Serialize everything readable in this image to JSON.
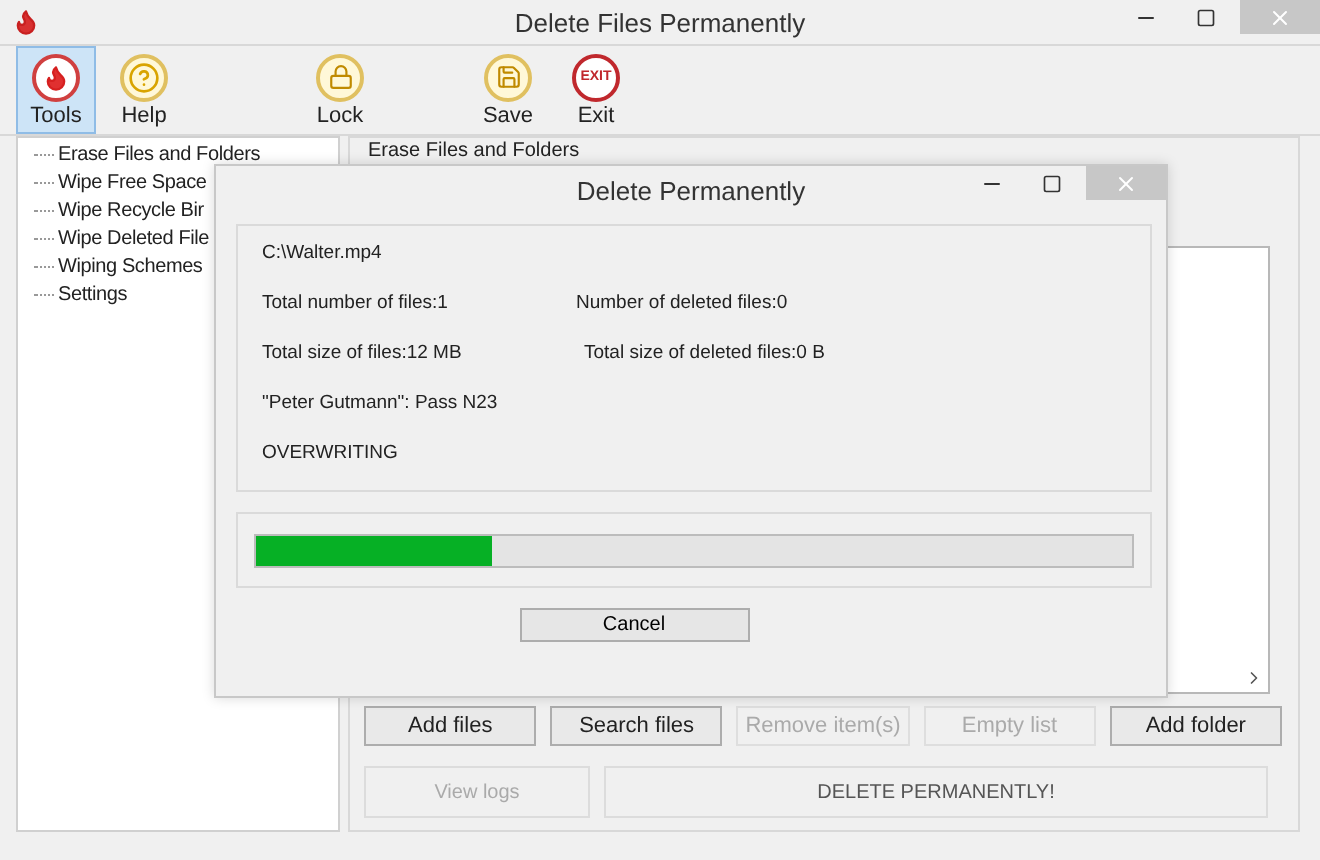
{
  "window": {
    "title": "Delete Files Permanently"
  },
  "toolbar": [
    {
      "kind": "tools",
      "label": "Tools",
      "selected": true
    },
    {
      "kind": "help",
      "label": "Help",
      "selected": false
    },
    {
      "kind": "lock",
      "label": "Lock",
      "selected": false
    },
    {
      "kind": "save",
      "label": "Save",
      "selected": false
    },
    {
      "kind": "exit",
      "label": "Exit",
      "icon_text": "EXIT",
      "selected": false
    }
  ],
  "tree": [
    {
      "label": "Erase Files and Folders"
    },
    {
      "label": "Wipe Free Space"
    },
    {
      "label": "Wipe Recycle Bir"
    },
    {
      "label": "Wipe Deleted File"
    },
    {
      "label": "Wiping Schemes"
    },
    {
      "label": "Settings"
    }
  ],
  "panel": {
    "title": "Erase Files and Folders"
  },
  "buttons": [
    {
      "label": "Add files",
      "disabled": false
    },
    {
      "label": "Search files",
      "disabled": false
    },
    {
      "label": "Remove item(s)",
      "disabled": true
    },
    {
      "label": "Empty list",
      "disabled": true
    },
    {
      "label": "Add folder",
      "disabled": false
    }
  ],
  "actions": [
    {
      "label": "View logs",
      "disabled": true
    },
    {
      "label": "DELETE PERMANENTLY!",
      "disabled": false
    }
  ],
  "dialog": {
    "title": "Delete Permanently",
    "path": "C:\\Walter.mp4",
    "stats": [
      [
        "Total number of files:1",
        "Number of deleted files:0"
      ],
      [
        "Total size of files:12 MB",
        "Total size of deleted files:0 B"
      ]
    ],
    "scheme": "\"Peter Gutmann\": Pass N23",
    "status": "OVERWRITING",
    "progress": {
      "level": 0.27
    },
    "cancel": "Cancel"
  }
}
